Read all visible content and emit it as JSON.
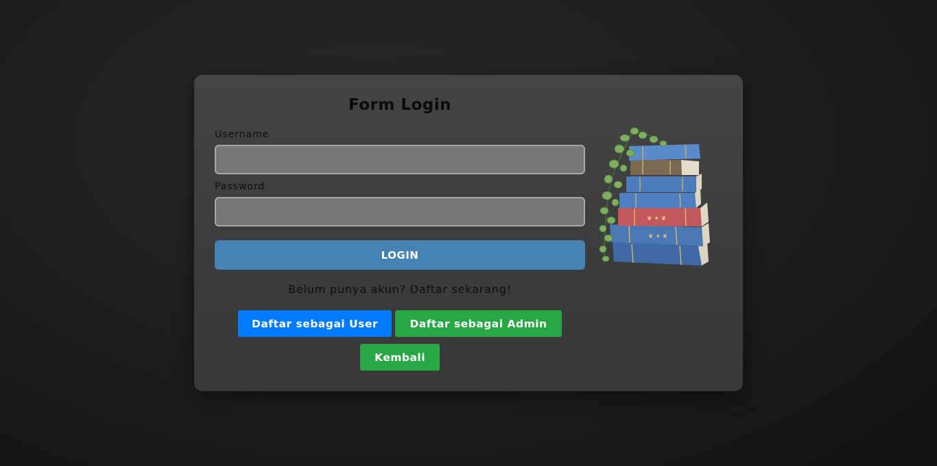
{
  "form": {
    "title": "Form Login",
    "username_label": "Username",
    "username_value": "",
    "password_label": "Password",
    "password_value": "",
    "login_label": "LOGIN",
    "register_prompt": "Belum punya akun? Daftar sekarang!",
    "register_user_label": "Daftar sebagai User",
    "register_admin_label": "Daftar sebagai Admin",
    "back_label": "Kembali"
  },
  "illustration": {
    "icon": "stacked-books-with-ivy"
  },
  "colors": {
    "login_button": "#4682b4",
    "user_button": "#007bff",
    "admin_button": "#28a745",
    "back_button": "#28a745"
  }
}
